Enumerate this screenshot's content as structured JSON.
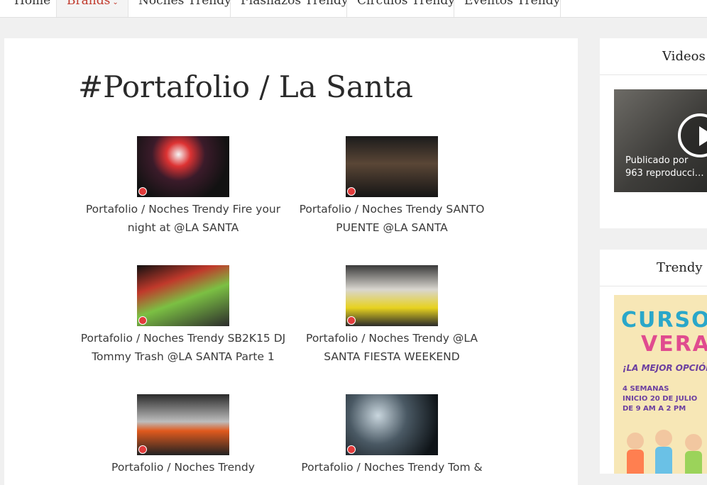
{
  "nav": {
    "items": [
      {
        "label": "Home"
      },
      {
        "label": "Brands"
      },
      {
        "label": "Noches Trendy"
      },
      {
        "label": "Flashazos Trendy"
      },
      {
        "label": "Circulos Trendy"
      },
      {
        "label": "Eventos Trendy"
      }
    ]
  },
  "main": {
    "title": "#Portafolio / La Santa",
    "gallery": [
      {
        "caption": "Portafolio / Noches Trendy Fire your night at @LA SANTA"
      },
      {
        "caption": "Portafolio / Noches Trendy SANTO PUENTE @LA SANTA"
      },
      {
        "caption": "Portafolio / Noches Trendy SB2K15 DJ Tommy Trash @LA SANTA Parte 1"
      },
      {
        "caption": "Portafolio / Noches Trendy @LA SANTA FIESTA WEEKEND"
      },
      {
        "caption": "Portafolio / Noches Trendy"
      },
      {
        "caption": "Portafolio / Noches Trendy Tom &"
      }
    ]
  },
  "sidebar": {
    "videos": {
      "title": "Videos",
      "published": "Publicado por",
      "views": "963 reproducci…"
    },
    "trendy": {
      "title": "Trendy P",
      "ad_line1": "CURSO",
      "ad_line2": "VERA",
      "ad_line3": "¡LA MEJOR OPCIÓN",
      "ad_line4a": "4 SEMANAS",
      "ad_line4b": "INICIO 20 DE JULIO",
      "ad_line4c": "DE 9 AM A 2 PM"
    }
  },
  "colors": {
    "accent": "#c0392b",
    "background": "#f0f0f0"
  }
}
